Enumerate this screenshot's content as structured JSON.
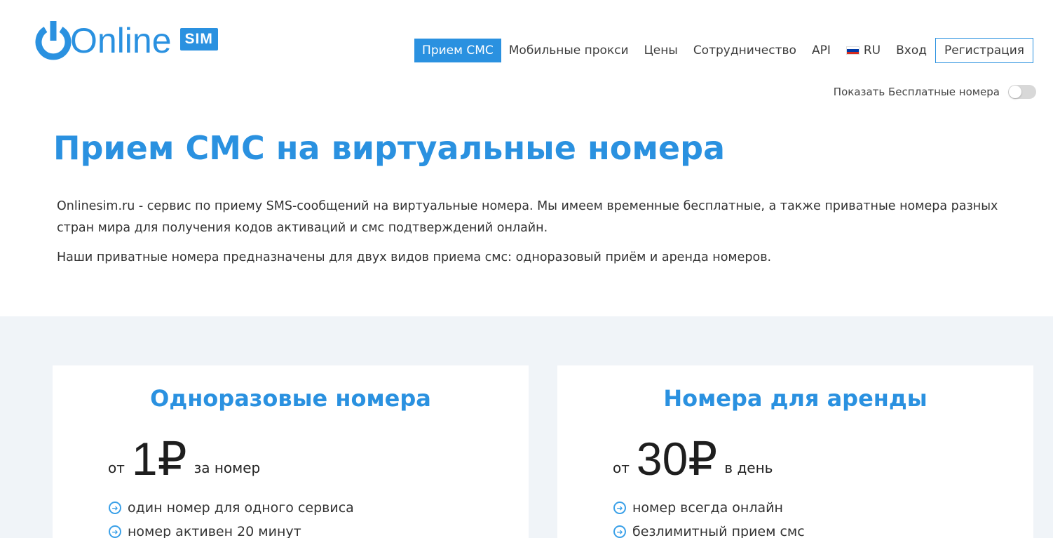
{
  "header": {
    "logo": {
      "word": "Online",
      "badge": "SIM"
    },
    "nav": [
      {
        "label": "Прием СМС",
        "active": true
      },
      {
        "label": "Мобильные прокси",
        "active": false
      },
      {
        "label": "Цены",
        "active": false
      },
      {
        "label": "Сотрудничество",
        "active": false
      },
      {
        "label": "API",
        "active": false
      }
    ],
    "language": {
      "label": "RU",
      "flag_icon": "russia-flag-icon"
    },
    "login_label": "Вход",
    "register_label": "Регистрация",
    "free_toggle": {
      "label": "Показать Бесплатные номера",
      "on": false
    }
  },
  "hero": {
    "title": "Прием СМС на виртуальные номера",
    "paragraph1": "Onlinesim.ru - сервис по приему SMS-сообщений на виртуальные номера. Мы имеем временные бесплатные, а также приватные номера разных стран мира для получения кодов активаций и смс подтверждений онлайн.",
    "paragraph2": "Наши приватные номера предназначены для двух видов приема смс: одноразовый приём и аренда номеров."
  },
  "plans": [
    {
      "title": "Одноразовые номера",
      "price_prefix": "от",
      "price": "1₽",
      "price_suffix": "за номер",
      "features": [
        "один номер для одного сервиса",
        "номер активен 20 минут"
      ]
    },
    {
      "title": "Номера для аренды",
      "price_prefix": "от",
      "price": "30₽",
      "price_suffix": "в день",
      "features": [
        "номер всегда онлайн",
        "безлимитный прием смс"
      ]
    }
  ],
  "colors": {
    "accent": "#2a91e0",
    "section_bg": "#f0f4f8",
    "text": "#333333"
  }
}
